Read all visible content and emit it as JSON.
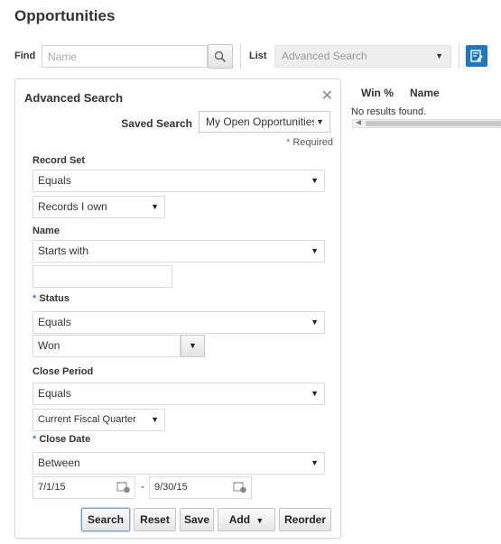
{
  "page": {
    "title": "Opportunities"
  },
  "toolbar": {
    "find_label": "Find",
    "find_placeholder": "Name",
    "find_value": "",
    "list_label": "List",
    "list_value": "Advanced Search"
  },
  "results": {
    "columns": [
      "Win %",
      "Name"
    ],
    "empty_message": "No results found."
  },
  "advanced_search": {
    "title": "Advanced Search",
    "saved_search_label": "Saved Search",
    "saved_search_value": "My Open Opportunities",
    "required_marker": "*",
    "required_label": "Required",
    "fields": {
      "record_set": {
        "label": "Record Set",
        "operator": "Equals",
        "value": "Records I own"
      },
      "name": {
        "label": "Name",
        "operator": "Starts with",
        "value": ""
      },
      "status": {
        "label": "Status",
        "required": "*",
        "operator": "Equals",
        "value": "Won"
      },
      "close_period": {
        "label": "Close Period",
        "operator": "Equals",
        "value": "Current Fiscal Quarter"
      },
      "close_date": {
        "label": "Close Date",
        "required": "*",
        "operator": "Between",
        "from": "7/1/15",
        "separator": "-",
        "to": "9/30/15"
      }
    },
    "buttons": {
      "search": "Search",
      "reset": "Reset",
      "save": "Save",
      "add": "Add",
      "reorder": "Reorder"
    }
  },
  "colors": {
    "accent": "#1d78c1",
    "required": "#2e8ed9"
  }
}
